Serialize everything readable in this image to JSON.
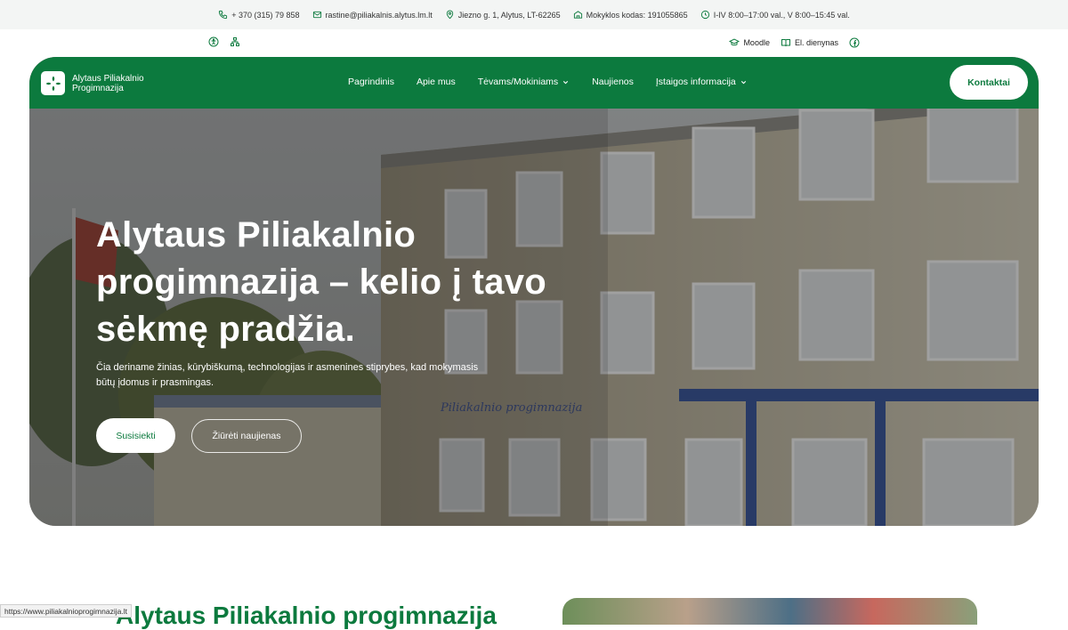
{
  "topbar": {
    "phone": "+ 370 (315) 79 858",
    "email": "rastine@piliakalnis.alytus.lm.lt",
    "address": "Jiezno g. 1, Alytus, LT-62265",
    "school_code": "Mokyklos kodas: 191055865",
    "hours": "I-IV  8:00–17:00 val., V 8:00–15:45 val."
  },
  "subbar": {
    "moodle": "Moodle",
    "diary": "El. dienynas"
  },
  "logo": {
    "line1": "Alytaus Piliakalnio",
    "line2": "Progimnazija"
  },
  "menu": {
    "home": "Pagrindinis",
    "about": "Apie mus",
    "parents": "Tėvams/Mokiniams",
    "news": "Naujienos",
    "info": "Įstaigos informacija",
    "contacts": "Kontaktai"
  },
  "hero": {
    "title": "Alytaus Piliakalnio progimnazija – kelio į tavo sėkmę pradžia.",
    "subtitle": "Čia deriname žinias, kūrybiškumą, technologijas ir asmenines stiprybes, kad mokymasis būtų įdomus ir prasmingas.",
    "cta_primary": "Susisiekti",
    "cta_secondary": "Žiūrėti naujienas",
    "building_sign": "Piliakalnio progimnazija"
  },
  "section": {
    "title": "Alytaus Piliakalnio progimnazija"
  },
  "status_url": "https://www.piliakalnioprogimnazija.lt",
  "colors": {
    "brand_green": "#0c7a3e",
    "topbar_bg": "#f3f5f4"
  }
}
